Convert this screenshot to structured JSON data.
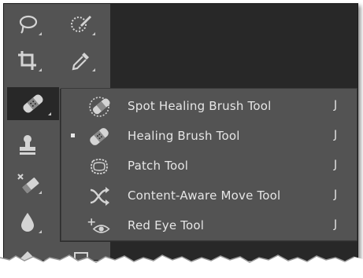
{
  "toolbar": {
    "tools": [
      {
        "name": "lasso-tool",
        "icon": "lasso-icon"
      },
      {
        "name": "quick-selection-tool",
        "icon": "quick-selection-icon"
      },
      {
        "name": "crop-tool",
        "icon": "crop-icon"
      },
      {
        "name": "eyedropper-tool",
        "icon": "eyedropper-icon"
      },
      {
        "name": "healing-brush-tool",
        "icon": "bandage-icon",
        "active": true
      },
      {
        "name": "clone-stamp-tool",
        "icon": "stamp-icon"
      },
      {
        "name": "eraser-tool",
        "icon": "eraser-icon"
      },
      {
        "name": "blur-tool",
        "icon": "drop-icon"
      }
    ]
  },
  "flyout": {
    "items": [
      {
        "label": "Spot Healing Brush Tool",
        "shortcut": "J",
        "icon": "spot-healing-brush-icon",
        "selected": false
      },
      {
        "label": "Healing Brush Tool",
        "shortcut": "J",
        "icon": "healing-brush-icon",
        "selected": true
      },
      {
        "label": "Patch Tool",
        "shortcut": "J",
        "icon": "patch-icon",
        "selected": false
      },
      {
        "label": "Content-Aware Move Tool",
        "shortcut": "J",
        "icon": "content-aware-move-icon",
        "selected": false
      },
      {
        "label": "Red Eye Tool",
        "shortcut": "J",
        "icon": "red-eye-icon",
        "selected": false
      }
    ]
  },
  "colors": {
    "panel": "#535353",
    "background": "#282828",
    "text": "#e6e6e6",
    "icon": "#d4d4d4"
  }
}
